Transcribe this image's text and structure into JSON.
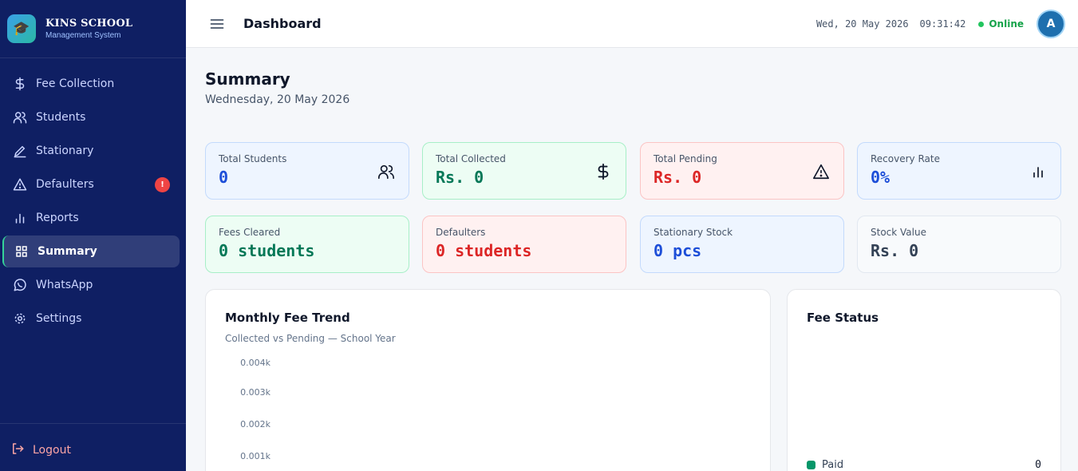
{
  "brand": {
    "title": "KINS SCHOOL",
    "subtitle": "Management System",
    "logo_icon": "graduation-cap-icon"
  },
  "sidebar": {
    "items": [
      {
        "label": "Fee Collection",
        "icon": "dollar-icon"
      },
      {
        "label": "Students",
        "icon": "users-icon"
      },
      {
        "label": "Stationary",
        "icon": "pen-icon"
      },
      {
        "label": "Defaulters",
        "icon": "warning-icon",
        "badge": "!"
      },
      {
        "label": "Reports",
        "icon": "bar-chart-icon"
      },
      {
        "label": "Summary",
        "icon": "grid-icon",
        "active": true
      },
      {
        "label": "WhatsApp",
        "icon": "whatsapp-icon"
      },
      {
        "label": "Settings",
        "icon": "gear-icon"
      }
    ],
    "logout_label": "Logout"
  },
  "header": {
    "title": "Dashboard",
    "date": "Wed, 20 May 2026",
    "time": "09:31:42",
    "status": "Online",
    "avatar_initial": "A"
  },
  "summary": {
    "title": "Summary",
    "date": "Wednesday, 20 May 2026"
  },
  "stats": [
    {
      "label": "Total Students",
      "value": "0",
      "icon": "users-icon"
    },
    {
      "label": "Total Collected",
      "value": "Rs. 0",
      "icon": "dollar-icon"
    },
    {
      "label": "Total Pending",
      "value": "Rs. 0",
      "icon": "warning-icon"
    },
    {
      "label": "Recovery Rate",
      "value": "0%",
      "icon": "bar-chart-icon"
    },
    {
      "label": "Fees Cleared",
      "value": "0 students"
    },
    {
      "label": "Defaulters",
      "value": "0 students"
    },
    {
      "label": "Stationary Stock",
      "value": "0 pcs"
    },
    {
      "label": "Stock Value",
      "value": "Rs. 0"
    }
  ],
  "trend": {
    "title": "Monthly Fee Trend",
    "subtitle": "Collected vs Pending — School Year",
    "y_ticks": [
      "0.004k",
      "0.003k",
      "0.002k",
      "0.001k"
    ]
  },
  "fee_status": {
    "title": "Fee Status",
    "legend": [
      {
        "label": "Paid",
        "value": "0"
      }
    ]
  },
  "colors": {
    "sidebar_bg": "#0f1f63",
    "accent_green": "#059669",
    "danger": "#dc2626",
    "primary_blue": "#1d4ed8"
  }
}
